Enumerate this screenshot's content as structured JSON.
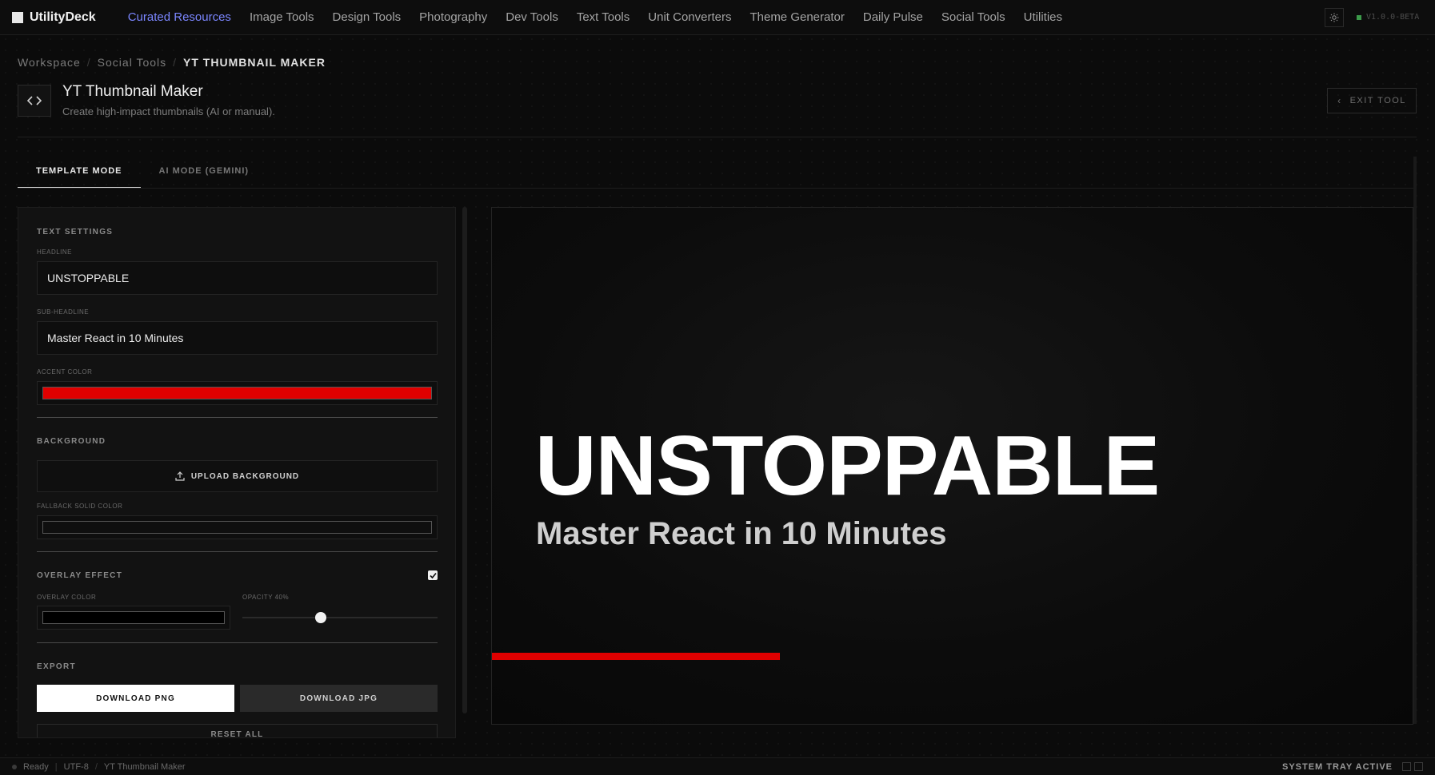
{
  "app": {
    "name": "UtilityDeck",
    "version": "V1.0.0-BETA"
  },
  "nav": [
    {
      "label": "Curated Resources",
      "active": true
    },
    {
      "label": "Image Tools"
    },
    {
      "label": "Design Tools"
    },
    {
      "label": "Photography"
    },
    {
      "label": "Dev Tools"
    },
    {
      "label": "Text Tools"
    },
    {
      "label": "Unit Converters"
    },
    {
      "label": "Theme Generator"
    },
    {
      "label": "Daily Pulse"
    },
    {
      "label": "Social Tools"
    },
    {
      "label": "Utilities"
    }
  ],
  "breadcrumb": [
    "Workspace",
    "Social Tools",
    "YT THUMBNAIL MAKER"
  ],
  "header": {
    "title": "YT Thumbnail Maker",
    "subtitle": "Create high-impact thumbnails (AI or manual).",
    "exit_label": "EXIT TOOL"
  },
  "tabs": [
    {
      "label": "TEMPLATE MODE",
      "active": true
    },
    {
      "label": "AI MODE (GEMINI)"
    }
  ],
  "text_settings": {
    "title": "TEXT SETTINGS",
    "headline_label": "HEADLINE",
    "headline_value": "UNSTOPPABLE",
    "subheadline_label": "SUB-HEADLINE",
    "subheadline_value": "Master React in 10 Minutes",
    "accent_label": "ACCENT COLOR",
    "accent_color": "#e00000"
  },
  "background": {
    "title": "BACKGROUND",
    "upload_label": "UPLOAD BACKGROUND",
    "fallback_label": "FALLBACK SOLID COLOR",
    "fallback_color": "#0f0f0f"
  },
  "overlay": {
    "title": "OVERLAY EFFECT",
    "enabled": true,
    "color_label": "OVERLAY COLOR",
    "color": "#000000",
    "opacity_label": "OPACITY 40%",
    "opacity": 0.4
  },
  "export": {
    "title": "EXPORT",
    "png_label": "DOWNLOAD PNG",
    "jpg_label": "DOWNLOAD JPG",
    "reset_label": "RESET ALL"
  },
  "preview": {
    "headline": "UNSTOPPABLE",
    "subheadline": "Master React in 10 Minutes"
  },
  "status": {
    "state": "Ready",
    "encoding": "UTF-8",
    "doc": "YT Thumbnail Maker",
    "tray": "SYSTEM TRAY ACTIVE"
  }
}
